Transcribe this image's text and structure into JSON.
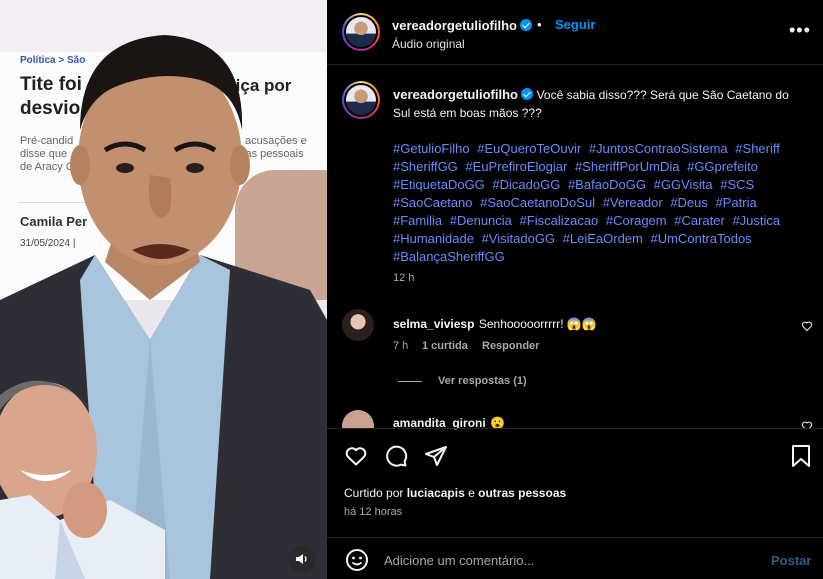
{
  "video": {
    "article": {
      "breadcrumb": "Política  >  São",
      "title_line1": "Tite foi",
      "title_line1_end": "tiça por",
      "title_line2": "desvio",
      "sub_left_1": "Pré-candid",
      "sub_left_2": "disse que",
      "sub_left_3": "de Aracy C",
      "sub_right_1": "acusações e",
      "sub_right_2": "sas pessoais",
      "author": "Camila Per",
      "date": "31/05/2024 |"
    },
    "sound_icon": "speaker-icon"
  },
  "post": {
    "header": {
      "username": "vereadorgetuliofilho",
      "separator": "•",
      "follow_label": "Seguir",
      "audio_label": "Áudio original",
      "more_icon": "more-options-icon"
    },
    "caption": {
      "username": "vereadorgetuliofilho",
      "text": "Você sabia disso??? Será que São Caetano do Sul está em boas mãos ???",
      "hashtags": [
        "#GetulioFilho",
        "#EuQueroTeOuvir",
        "#JuntosContraoSistema",
        "#Sheriff",
        "#SheriffGG",
        "#EuPrefiroElogiar",
        "#SheriffPorUmDia",
        "#GGprefeito",
        "#EtiquetaDoGG",
        "#DicadoGG",
        "#BafaoDoGG",
        "#GGVisita",
        "#SCS",
        "#SaoCaetano",
        "#SaoCaetanoDoSul",
        "#Vereador",
        "#Deus",
        "#Patria",
        "#Familia",
        "#Denuncia",
        "#Fiscalizacao",
        "#Coragem",
        "#Carater",
        "#Justica",
        "#Humanidade",
        "#VisitadoGG",
        "#LeiEaOrdem",
        "#UmContraTodos",
        "#BalançaSheriffGG"
      ],
      "time": "12 h"
    },
    "comments": [
      {
        "username": "selma_viviesp",
        "text": "Senhooooorrrrr! 😱😱",
        "time": "7 h",
        "likes": "1 curtida",
        "reply": "Responder",
        "view_replies": "Ver respostas (1)"
      },
      {
        "username": "amandita_gironi",
        "text": "😮"
      }
    ],
    "liked_by": {
      "prefix": "Curtido por",
      "user": "luciacapis",
      "conj": "e",
      "others": "outras pessoas"
    },
    "ago": "há 12 horas",
    "add_comment_placeholder": "Adicione um comentário...",
    "post_label": "Postar"
  },
  "colors": {
    "link_blue": "#0095f6",
    "hashtag_blue": "#6b8afd",
    "muted": "#a8a8a8"
  }
}
